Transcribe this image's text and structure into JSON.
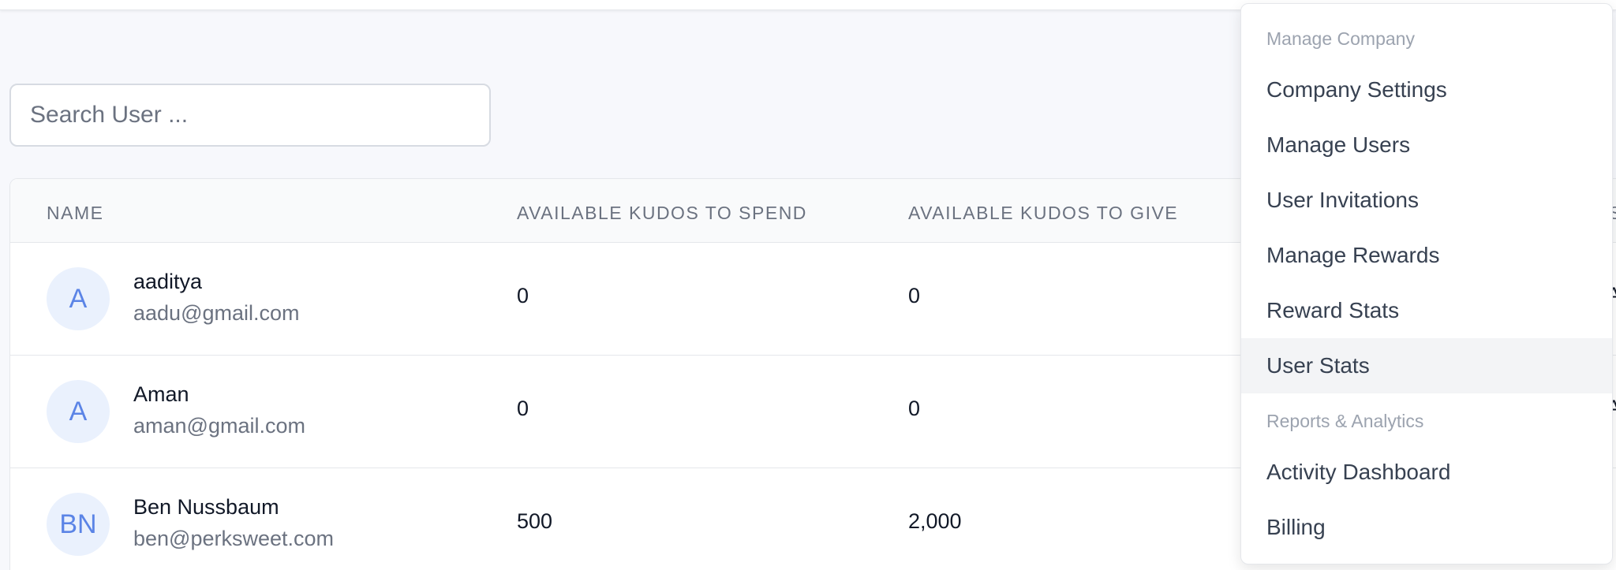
{
  "search": {
    "placeholder": "Search User ..."
  },
  "table": {
    "columns": [
      "NAME",
      "AVAILABLE KUDOS TO SPEND",
      "AVAILABLE KUDOS TO GIVE"
    ],
    "next_column_glyph": "S",
    "rows": [
      {
        "initials": "A",
        "name": "aaditya",
        "email": "aadu@gmail.com",
        "spend": "0",
        "give": "0",
        "edge": "A"
      },
      {
        "initials": "A",
        "name": "Aman",
        "email": "aman@gmail.com",
        "spend": "0",
        "give": "0",
        "edge": "A"
      },
      {
        "initials": "BN",
        "name": "Ben Nussbaum",
        "email": "ben@perksweet.com",
        "spend": "500",
        "give": "2,000",
        "edge": ":"
      }
    ]
  },
  "menu": {
    "section_manage": "Manage Company",
    "section_reports": "Reports & Analytics",
    "items": [
      {
        "label": "Company Settings"
      },
      {
        "label": "Manage Users"
      },
      {
        "label": "User Invitations"
      },
      {
        "label": "Manage Rewards"
      },
      {
        "label": "Reward Stats"
      },
      {
        "label": "User Stats"
      },
      {
        "label": "Activity Dashboard"
      },
      {
        "label": "Billing"
      }
    ],
    "active_label": "User Stats"
  },
  "colors": {
    "avatar_bg": "#eaf1fd",
    "avatar_text": "#5b84e6",
    "menu_active_bg": "#f3f4f6"
  }
}
